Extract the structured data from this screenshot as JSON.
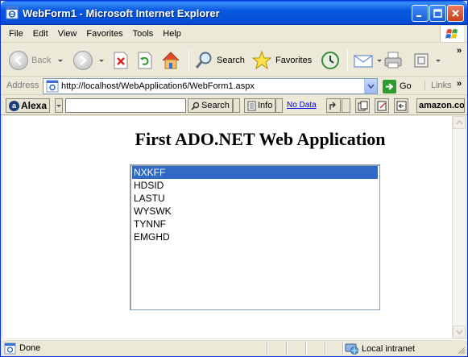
{
  "window": {
    "title": "WebForm1 - Microsoft Internet Explorer"
  },
  "menu": {
    "items": [
      "File",
      "Edit",
      "View",
      "Favorites",
      "Tools",
      "Help"
    ]
  },
  "toolbar": {
    "back_label": "Back",
    "search_label": "Search",
    "favorites_label": "Favorites",
    "chevron": "»"
  },
  "address": {
    "label": "Address",
    "url": "http://localhost/WebApplication6/WebForm1.aspx",
    "go_label": "Go",
    "links_label": "Links",
    "chevron": "»"
  },
  "alexa": {
    "logo_label": "Alexa",
    "search_label": "Search",
    "info_label": "Info",
    "nodata_label": "No Data",
    "amazon_label": "amazon.com"
  },
  "page": {
    "heading": "First ADO.NET Web Application",
    "listbox": {
      "options": [
        "NXKFF",
        "HDSID",
        "LASTU",
        "WYSWK",
        "TYNNF",
        "EMGHD"
      ],
      "selected_index": 0
    }
  },
  "status": {
    "text": "Done",
    "zone": "Local intranet"
  },
  "colors": {
    "selection": "#316ac5",
    "titlebar": "#0658e0"
  }
}
